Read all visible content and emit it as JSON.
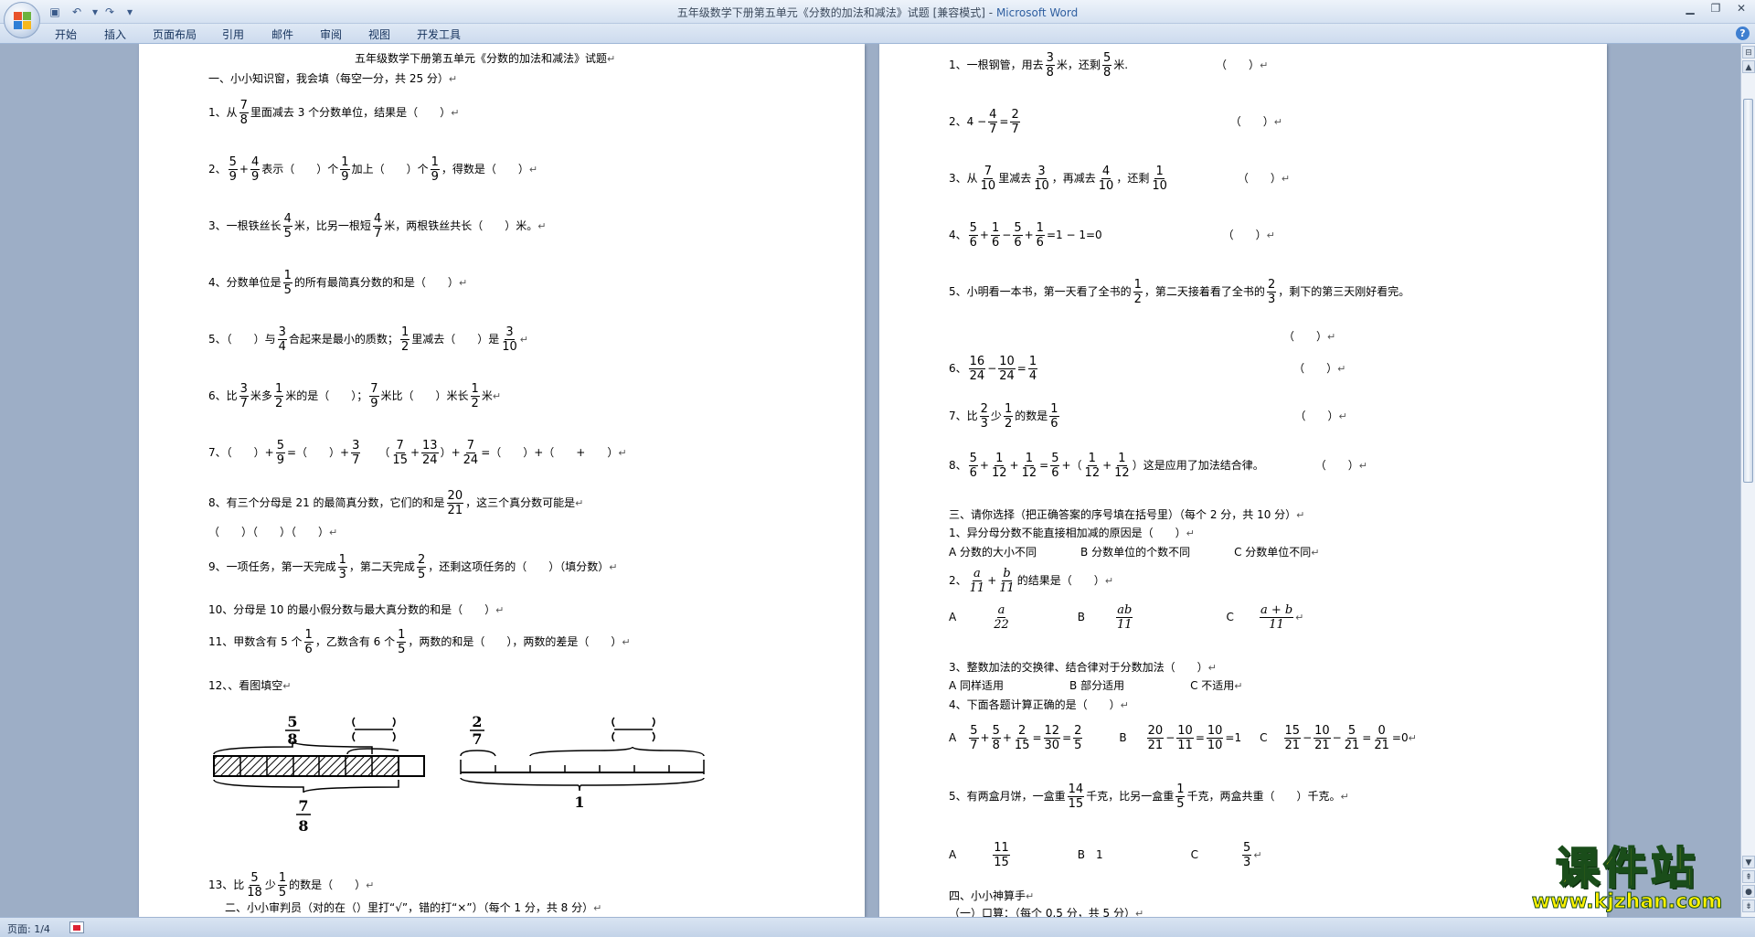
{
  "window": {
    "title_doc": "五年级数学下册第五单元《分数的加法和减法》试题 [兼容模式]",
    "title_sep": " - ",
    "title_app": "Microsoft Word"
  },
  "ribbon": {
    "tabs": [
      "开始",
      "插入",
      "页面布局",
      "引用",
      "邮件",
      "审阅",
      "视图",
      "开发工具"
    ]
  },
  "status": {
    "page": "页面: 1/4"
  },
  "watermark": {
    "big": "课件站",
    "small": "www.kjzhan.com"
  },
  "left_page": {
    "title": "五年级数学下册第五单元《分数的加法和减法》试题",
    "section1": "一、小小知识窗，我会填（每空一分，共 25 分）",
    "q1": [
      "1、从",
      "里面减去 3 个分数单位，结果是（　　）"
    ],
    "q2": [
      "2、",
      "表示（　　）个",
      "加上（　　）个",
      "，得数是（　　）"
    ],
    "q3": [
      "3、一根铁丝长",
      "米，比另一根短",
      "米，两根铁丝共长（　　）米。"
    ],
    "q4": [
      "4、分数单位是",
      "的所有最简真分数的和是（　　）"
    ],
    "q5": [
      "5、（　　）与",
      "合起来是最小的质数；",
      "里减去（　　）是"
    ],
    "q6": [
      "6、比",
      "米多",
      "米的是（　　）；",
      "米比（　　）米长",
      "米"
    ],
    "q7": [
      "7、（　　）+",
      "=（　　）+",
      "（",
      "+",
      "）+",
      "=（　　）+（　　+　　）"
    ],
    "q8": [
      "8、有三个分母是 21 的最简真分数，它们的和是",
      "，这三个真分数可能是"
    ],
    "q8b": "（　　）（　　）（　　）",
    "q9": [
      "9、一项任务，第一天完成",
      "，第二天完成",
      "，还剩这项任务的（　　）（填分数）"
    ],
    "q10": "10、分母是 10 的最小假分数与最大真分数的和是（　　）",
    "q11": [
      "11、甲数含有 5 个",
      "，乙数含有 6 个",
      "，两数的和是（　　），两数的差是（　　）"
    ],
    "q12": "12、、看图填空",
    "q13": [
      "13、比",
      "少",
      "的数是（　　）"
    ],
    "section2": "二、小小审判员（对的在（）里打“√”，错的打“×”）（每个 1 分，共 8 分）",
    "diagram": {
      "top_left": "5/8",
      "bottom_left": "7/8",
      "top_right": "2/7",
      "bottom_right": "1"
    }
  },
  "right_page": {
    "r1": [
      "1、一根钢管，用去",
      "米，还剩",
      "米.",
      "（　　）"
    ],
    "r2": [
      "2、4 −",
      "=",
      "（　　）"
    ],
    "r3": [
      "3、从",
      "里减去",
      "，再减去",
      "，还剩",
      "（　　）"
    ],
    "r4": [
      "4、",
      "+",
      "−",
      "+",
      "=1 − 1=0",
      "（　　）"
    ],
    "r5": [
      "5、小明看一本书，第一天看了全书的",
      "，第二天接着看了全书的",
      "，剩下的第三天刚好看完。"
    ],
    "r5b": "（　　）",
    "r6": [
      "6、",
      "−",
      "=",
      "（　　）"
    ],
    "r7": [
      "7、比",
      "少",
      "的数是",
      "（　　）"
    ],
    "r8": [
      "8、",
      "+",
      "+",
      "=",
      "+（",
      "+",
      "）这是应用了加法结合律。",
      "（　　）"
    ],
    "section3": "三、请你选择（把正确答案的序号填在括号里）（每个 2 分，共 10 分）",
    "c1": "1、异分母分数不能直接相加减的原因是（　　）",
    "c1opts": "A 分数的大小不同　　　　B 分数单位的个数不同　　　　C 分数单位不同",
    "c2": [
      "2、",
      "+",
      "的结果是（　　）"
    ],
    "c2opts": [
      "A",
      "B",
      "C"
    ],
    "c3": "3、整数加法的交换律、结合律对于分数加法（　　）",
    "c3opts": "A 同样适用　　　　　　B 部分适用　　　　　　C 不适用",
    "c4": "4、下面各题计算正确的是（　　）",
    "c4opts": [
      "A",
      "B",
      "C"
    ],
    "c5": [
      "5、有两盒月饼，一盒重",
      "千克，比另一盒重",
      "千克，两盒共重（　　）千克。"
    ],
    "c5opts": [
      "A",
      "B　1",
      "C"
    ],
    "section4": "四、小小神算手",
    "section4a": "（一）口算：（每个 0.5 分，共 5 分）"
  }
}
